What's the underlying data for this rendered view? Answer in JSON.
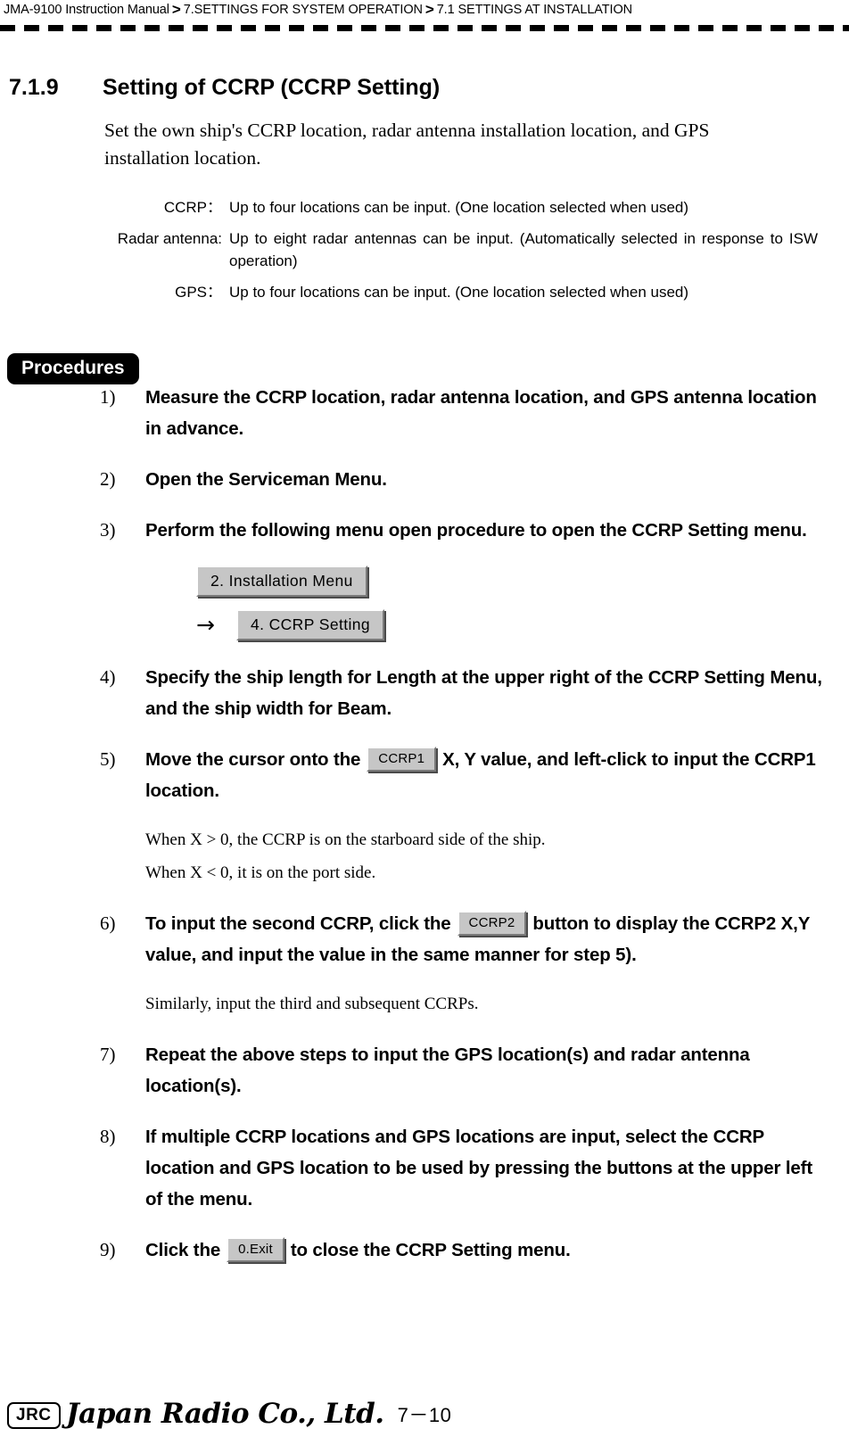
{
  "header": {
    "breadcrumb": [
      "JMA-9100 Instruction Manual",
      "7.SETTINGS FOR SYSTEM OPERATION",
      "7.1  SETTINGS AT INSTALLATION"
    ],
    "separator": ">"
  },
  "section": {
    "number": "7.1.9",
    "title": "Setting of CCRP (CCRP Setting)",
    "intro": "Set the own ship's CCRP location, radar antenna installation location, and GPS installation location."
  },
  "definitions": [
    {
      "term": "CCRP：",
      "description": "Up to four locations can be input. (One location selected when used)"
    },
    {
      "term": "Radar antenna:",
      "description": "Up to eight radar antennas can be input. (Automatically selected in response to ISW operation)"
    },
    {
      "term": "GPS：",
      "description": "Up to four locations can be input. (One location selected when used)"
    }
  ],
  "procedures": {
    "badge": "Procedures",
    "steps": [
      {
        "number": "1)",
        "text": "Measure the CCRP location, radar antenna location, and GPS antenna location in advance."
      },
      {
        "number": "2)",
        "text": "Open the Serviceman Menu."
      },
      {
        "number": "3)",
        "text": "Perform the following menu open procedure to open the CCRP Setting menu."
      },
      {
        "number": "4)",
        "text": "Specify the ship length for Length at the upper right of the CCRP Setting Menu, and the ship width for Beam."
      },
      {
        "number": "5)",
        "text_before": "Move the cursor onto the",
        "button": "CCRP1",
        "text_after": "X, Y value, and left-click to input the CCRP1 location."
      },
      {
        "number": "6)",
        "text_before": "To input the second CCRP, click the",
        "button": "CCRP2",
        "text_after": "button to display the CCRP2 X,Y value, and input the value in the same manner for step 5)."
      },
      {
        "number": "7)",
        "text": "Repeat the above steps to input the GPS location(s) and radar antenna location(s)."
      },
      {
        "number": "8)",
        "text": "If multiple CCRP locations and GPS locations are input, select the CCRP location and GPS location to be used by pressing the buttons at the upper left of the menu."
      },
      {
        "number": "9)",
        "text_before": "Click the",
        "button": "0.Exit",
        "text_after": "to close the CCRP Setting menu."
      }
    ],
    "menu_flow": {
      "step1_button": "2. Installation Menu",
      "arrow": "→",
      "step2_button": "4. CCRP Setting"
    },
    "notes": {
      "note_x_positive": "When X > 0, the CCRP is on the starboard side of the ship.",
      "note_x_negative": "When X < 0, it is on the port side.",
      "note_similar": "Similarly, input the third and subsequent CCRPs."
    }
  },
  "footer": {
    "logo_mark": "JRC",
    "company": "Japan Radio Co., Ltd.",
    "page_number": "7－10"
  }
}
